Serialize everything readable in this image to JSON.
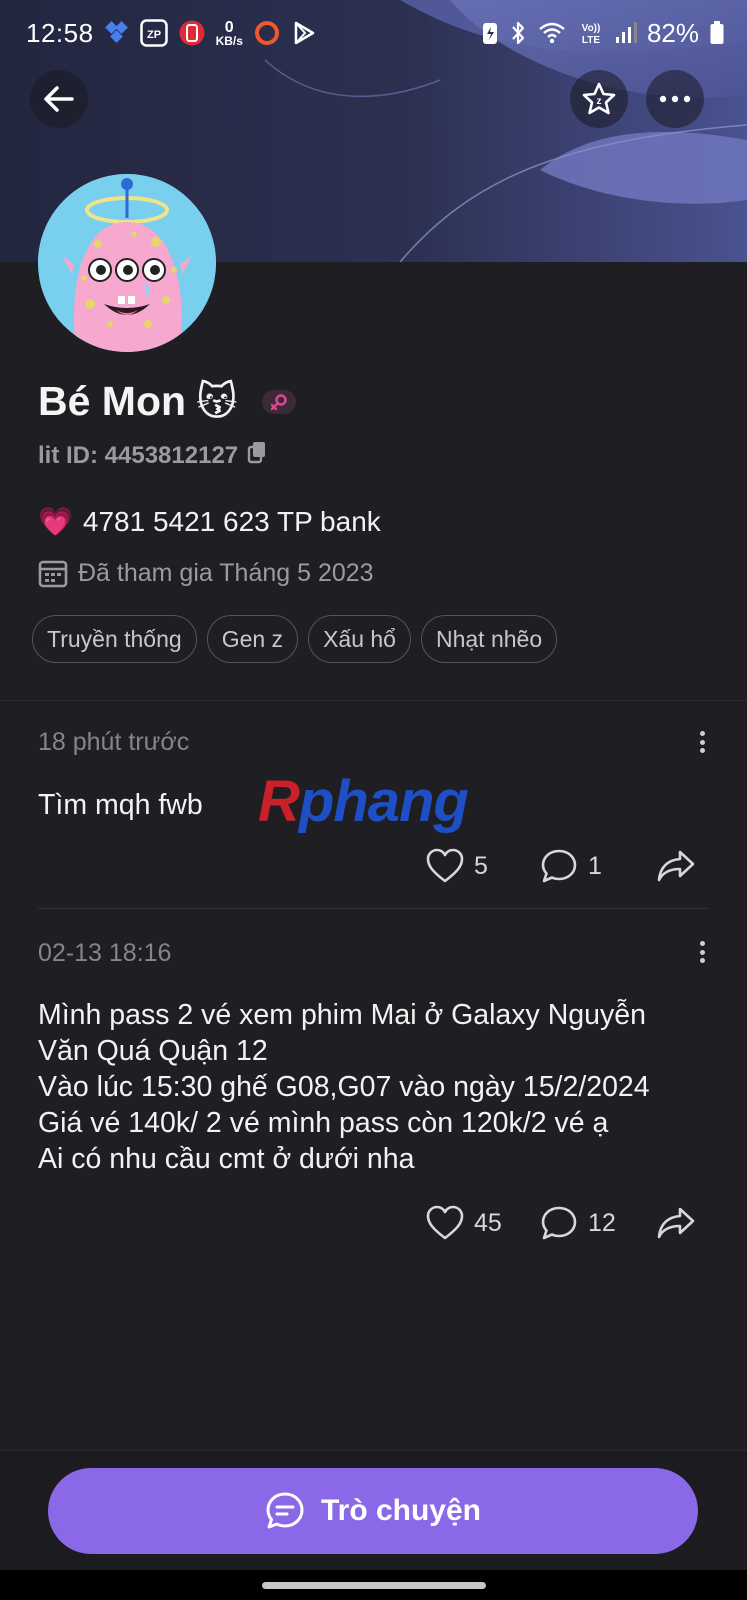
{
  "status_bar": {
    "time": "12:58",
    "net_speed_value": "0",
    "net_speed_unit": "KB/s",
    "network_label": "LTE",
    "battery": "82%"
  },
  "profile": {
    "name": "Bé Mon",
    "name_emoji": "😽",
    "lit_id": "lit ID: 4453812127",
    "bio_emoji": "💗",
    "bio": "4781 5421 623 TP bank",
    "joined": "Đã tham gia Tháng 5 2023",
    "tags": [
      "Truyền thống",
      "Gen z",
      "Xấu hổ",
      "Nhạt nhẽo"
    ]
  },
  "posts": [
    {
      "time": "18 phút trước",
      "text": "Tìm mqh fwb",
      "likes": "5",
      "comments": "1"
    },
    {
      "time": "02-13 18:16",
      "text": "Mình pass 2 vé xem phim Mai ở Galaxy Nguyễn\nVăn Quá Quận 12\nVào lúc 15:30 ghế G08,G07 vào ngày 15/2/2024\nGiá vé 140k/ 2 vé mình pass còn 120k/2 vé ạ\nAi có nhu cầu cmt ở dưới nha",
      "likes": "45",
      "comments": "12"
    }
  ],
  "watermark": {
    "first": "R",
    "rest": "phang"
  },
  "chat_button": {
    "label": "Trò chuyện"
  },
  "colors": {
    "background": "#1f1e23",
    "accent": "#8a68e8",
    "banner": "#2a2d4a",
    "muted_text": "#85848a"
  },
  "icons": [
    "back-arrow-icon",
    "star-icon",
    "more-icon",
    "copy-icon",
    "calendar-icon",
    "heart-icon",
    "comment-icon",
    "share-icon",
    "chat-icon"
  ]
}
